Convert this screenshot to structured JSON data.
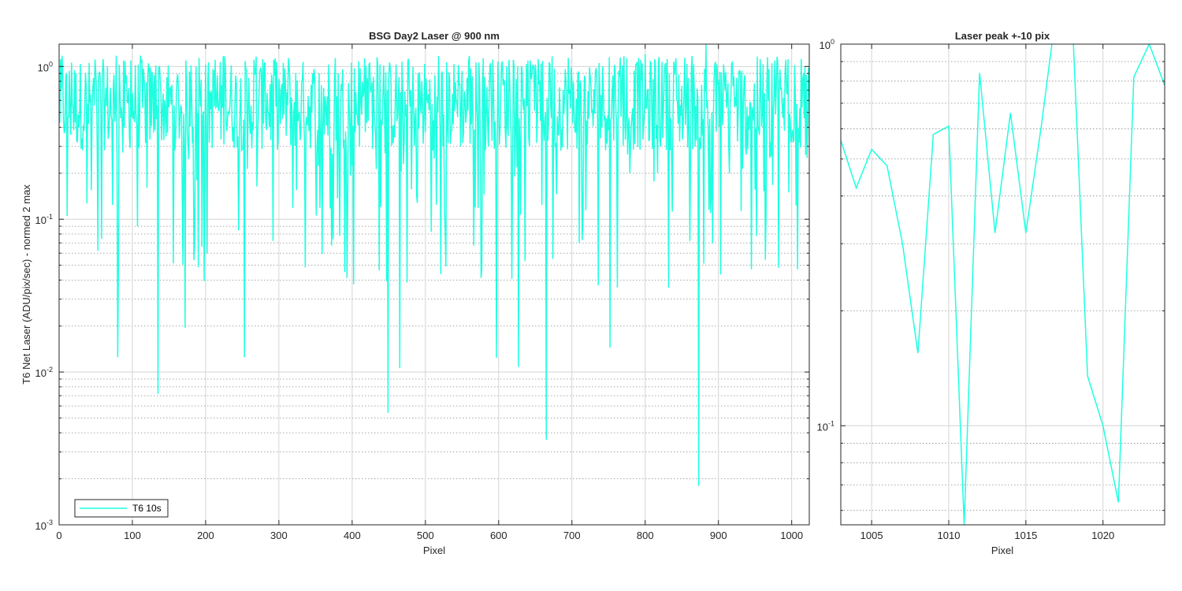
{
  "colors": {
    "series": "#1effe0",
    "grid": "#d4d4d4",
    "axis": "#262626",
    "background": "#ffffff"
  },
  "chart_data": [
    {
      "type": "line",
      "title": "BSG  Day2 Laser @ 900 nm",
      "xlabel": "Pixel",
      "ylabel": "T6 Net Laser (ADU/pix/sec) - normed 2 max",
      "xlim": [
        0,
        1024
      ],
      "ylim": [
        0.001,
        1.4
      ],
      "yscale": "log",
      "grid": true,
      "minor_grid": true,
      "xticks": [
        0,
        100,
        200,
        300,
        400,
        500,
        600,
        700,
        800,
        900,
        1000
      ],
      "xtick_labels": [
        "0",
        "100",
        "200",
        "300",
        "400",
        "500",
        "600",
        "700",
        "800",
        "900",
        "1000"
      ],
      "yticks": [
        0.001,
        0.01,
        0.1,
        1
      ],
      "ytick_labels": [
        "10",
        "10",
        "10",
        "10"
      ],
      "ytick_exponents": [
        "-3",
        "-2",
        "-1",
        "0"
      ],
      "legend": {
        "location": "bottom-left",
        "entries": [
          "T6 10s"
        ]
      },
      "notable_points": [
        {
          "x": 80,
          "y": 0.0125
        },
        {
          "x": 135,
          "y": 0.0072
        },
        {
          "x": 172,
          "y": 0.0195
        },
        {
          "x": 253,
          "y": 0.0125
        },
        {
          "x": 449,
          "y": 0.0054
        },
        {
          "x": 465,
          "y": 0.0106
        },
        {
          "x": 597,
          "y": 0.0124
        },
        {
          "x": 627,
          "y": 0.0108
        },
        {
          "x": 665,
          "y": 0.0036
        },
        {
          "x": 752,
          "y": 0.0145
        },
        {
          "x": 873,
          "y": 0.0018
        },
        {
          "x": 883,
          "y": 1.4
        },
        {
          "x": 1018,
          "y": 1.0
        },
        {
          "x": 1023,
          "y": 0.98
        }
      ],
      "series": [
        {
          "name": "T6 10s",
          "x_start": 1,
          "x_step": 1,
          "count": 1024,
          "typical_range": [
            0.25,
            1.0
          ]
        }
      ]
    },
    {
      "type": "line",
      "title": "Laser peak +-10 pix",
      "xlabel": "Pixel",
      "ylabel": "",
      "xlim": [
        1003,
        1024
      ],
      "ylim": [
        0.055,
        1.0
      ],
      "yscale": "log",
      "grid": true,
      "minor_grid": true,
      "xticks": [
        1005,
        1010,
        1015,
        1020
      ],
      "xtick_labels": [
        "1005",
        "1010",
        "1015",
        "1020"
      ],
      "yticks": [
        0.1,
        1
      ],
      "ytick_labels": [
        "10",
        "10"
      ],
      "ytick_exponents": [
        "-1",
        "0"
      ],
      "series": [
        {
          "name": "T6 10s",
          "x": [
            1003,
            1004,
            1005,
            1006,
            1007,
            1008,
            1009,
            1010,
            1011,
            1012,
            1013,
            1014,
            1015,
            1016,
            1017,
            1018,
            1019,
            1020,
            1021,
            1022,
            1023,
            1024
          ],
          "y": [
            0.56,
            0.42,
            0.53,
            0.48,
            0.3,
            0.155,
            0.58,
            0.61,
            0.055,
            0.84,
            0.32,
            0.66,
            0.32,
            0.61,
            1.25,
            1.2,
            0.135,
            0.1,
            0.063,
            0.82,
            1.0,
            0.78
          ]
        }
      ]
    }
  ]
}
